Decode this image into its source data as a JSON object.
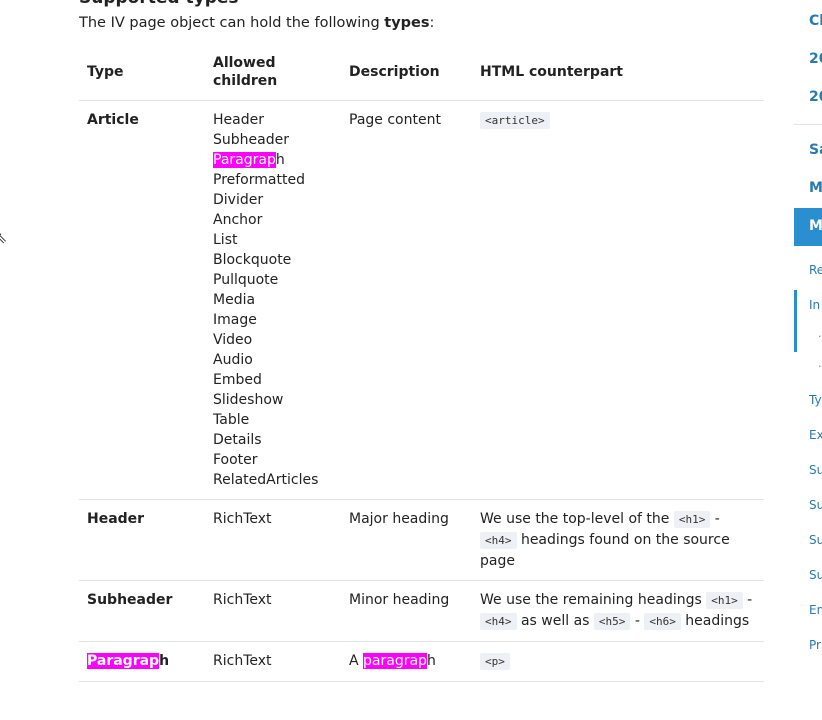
{
  "section_heading": "Supported types",
  "intro": {
    "text_before": "The IV page object can hold the following ",
    "bold": "types",
    "text_after": ":"
  },
  "table": {
    "headers": [
      "Type",
      "Allowed children",
      "Description",
      "HTML counterpart"
    ],
    "rows": [
      {
        "type": "Article",
        "children": [
          "Header",
          "Subheader",
          "Paragraph",
          "Preformatted",
          "Divider",
          "Anchor",
          "List",
          "Blockquote",
          "Pullquote",
          "Media",
          "Image",
          "Video",
          "Audio",
          "Embed",
          "Slideshow",
          "Table",
          "Details",
          "Footer",
          "RelatedArticles"
        ],
        "description": "Page content",
        "html": "<article>"
      },
      {
        "type": "Header",
        "children": [
          "RichText"
        ],
        "description": "Major heading",
        "html_parts": [
          "We use the top-level of the ",
          "<h1>",
          " - ",
          "<h4>",
          " headings found on the source page"
        ]
      },
      {
        "type": "Subheader",
        "children": [
          "RichText"
        ],
        "description": "Minor heading",
        "html_parts": [
          "We use the remaining headings ",
          "<h1>",
          " - ",
          "<h4>",
          " as well as ",
          "<h5>",
          " - ",
          "<h6>",
          " headings"
        ]
      },
      {
        "type": "Paragraph",
        "children": [
          "RichText"
        ],
        "description": "A paragraph",
        "html": "<p>"
      }
    ]
  },
  "search_highlight": "Paragrap",
  "search_highlight_lower": "paragrap",
  "sidebar": {
    "items": [
      "Cl",
      "20",
      "20",
      "Sa",
      "M",
      "M",
      "Re",
      "In",
      "Ty",
      "Ex",
      "Su",
      "Su",
      "Su",
      "Su",
      "En",
      "Pr"
    ],
    "active": "M"
  },
  "colors": {
    "highlight": "#ff00ff",
    "link": "#2a7ab0",
    "active_bg": "#2a8fd0",
    "code_bg": "#edf1f5"
  }
}
